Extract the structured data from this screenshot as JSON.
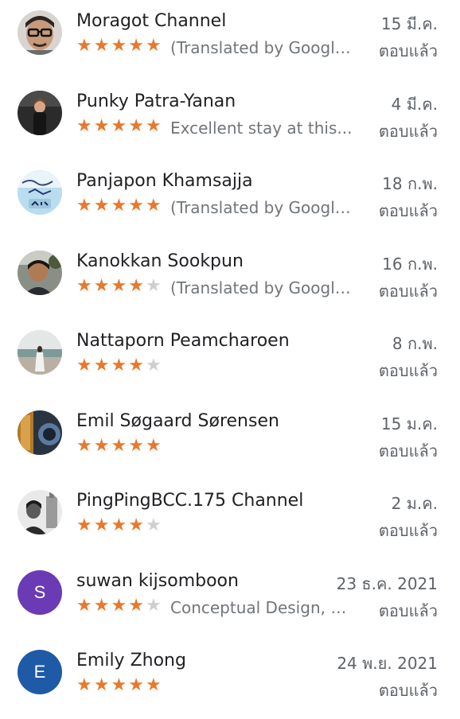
{
  "colors": {
    "star_on": "#e8792b",
    "star_off": "#cfcfcf",
    "avatar_purple": "#6a3bb5",
    "avatar_blue": "#1f5aa6"
  },
  "reviews": [
    {
      "name": "Moragot Channel",
      "date": "15 มี.ค.",
      "rating": 5,
      "snippet": "(Translated by Google) ...",
      "status": "ตอบแล้ว",
      "avatar": "photo"
    },
    {
      "name": "Punky Patra-Yanan",
      "date": "4 มี.ค.",
      "rating": 5,
      "snippet": "Excellent stay at this...",
      "status": "ตอบแล้ว",
      "avatar": "photo"
    },
    {
      "name": "Panjapon Khamsajja",
      "date": "18 ก.พ.",
      "rating": 5,
      "snippet": "(Translated by Google) ...",
      "status": "ตอบแล้ว",
      "avatar": "photo"
    },
    {
      "name": "Kanokkan Sookpun",
      "date": "16 ก.พ.",
      "rating": 4,
      "snippet": "(Translated by Google) ...",
      "status": "ตอบแล้ว",
      "avatar": "photo"
    },
    {
      "name": "Nattaporn Peamcharoen",
      "date": "8 ก.พ.",
      "rating": 4,
      "snippet": "",
      "status": "ตอบแล้ว",
      "avatar": "photo"
    },
    {
      "name": "Emil Søgaard Sørensen",
      "date": "15 ม.ค.",
      "rating": 5,
      "snippet": "",
      "status": "ตอบแล้ว",
      "avatar": "photo"
    },
    {
      "name": "PingPingBCC.175 Channel",
      "date": "2 ม.ค.",
      "rating": 4,
      "snippet": "",
      "status": "ตอบแล้ว",
      "avatar": "photo"
    },
    {
      "name": "suwan kijsomboon",
      "date": "23 ธ.ค. 2021",
      "rating": 4,
      "snippet": "Conceptual Design, Ti...",
      "status": "ตอบแล้ว",
      "avatar": "letter",
      "initial": "S"
    },
    {
      "name": "Emily Zhong",
      "date": "24 พ.ย. 2021",
      "rating": 5,
      "snippet": "",
      "status": "ตอบแล้ว",
      "avatar": "letter",
      "initial": "E"
    }
  ]
}
